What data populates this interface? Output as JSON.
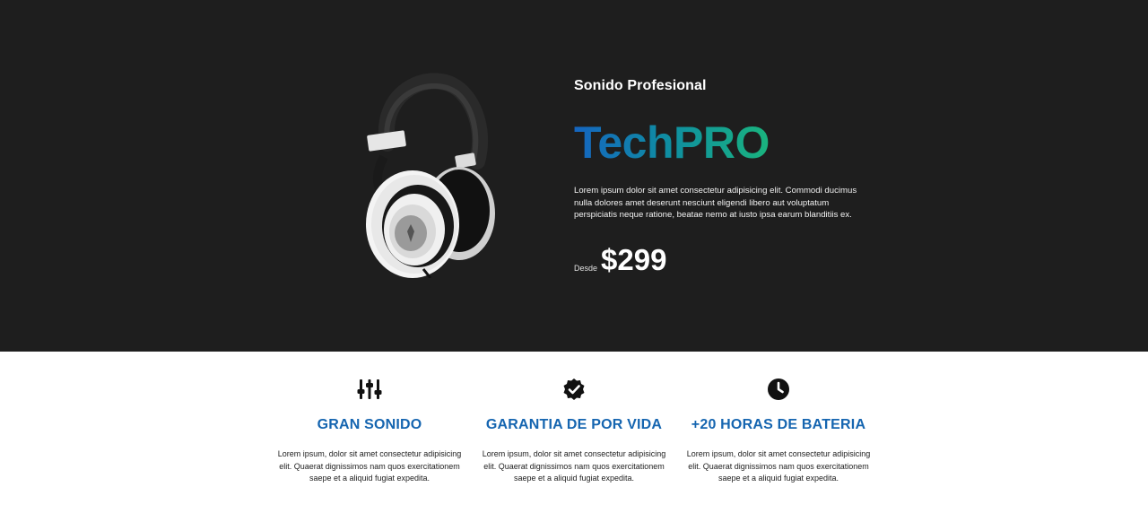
{
  "hero": {
    "subtitle": "Sonido Profesional",
    "brand": "TechPRO",
    "description": "Lorem ipsum dolor sit amet consectetur adipisicing elit. Commodi ducimus nulla dolores amet deserunt nesciunt eligendi libero aut voluptatum perspiciatis neque ratione, beatae nemo at iusto ipsa earum blanditiis ex.",
    "price_prefix": "Desde",
    "price": "$299",
    "image_icon": "headphones-image",
    "colors": {
      "background": "#1e1e1e",
      "brand_gradient": [
        "#1565c0",
        "#1ab47e"
      ]
    }
  },
  "features": [
    {
      "icon": "sliders-icon",
      "title": "GRAN SONIDO",
      "text": "Lorem ipsum, dolor sit amet consectetur adipisicing elit. Quaerat dignissimos nam quos exercitationem saepe et a aliquid fugiat expedita."
    },
    {
      "icon": "badge-check-icon",
      "title": "GARANTIA DE POR VIDA",
      "text": "Lorem ipsum, dolor sit amet consectetur adipisicing elit. Quaerat dignissimos nam quos exercitationem saepe et a aliquid fugiat expedita."
    },
    {
      "icon": "clock-icon",
      "title": "+20 HORAS DE BATERIA",
      "text": "Lorem ipsum, dolor sit amet consectetur adipisicing elit. Quaerat dignissimos nam quos exercitationem saepe et a aliquid fugiat expedita."
    }
  ],
  "colors": {
    "feature_title": "#1565b0"
  }
}
